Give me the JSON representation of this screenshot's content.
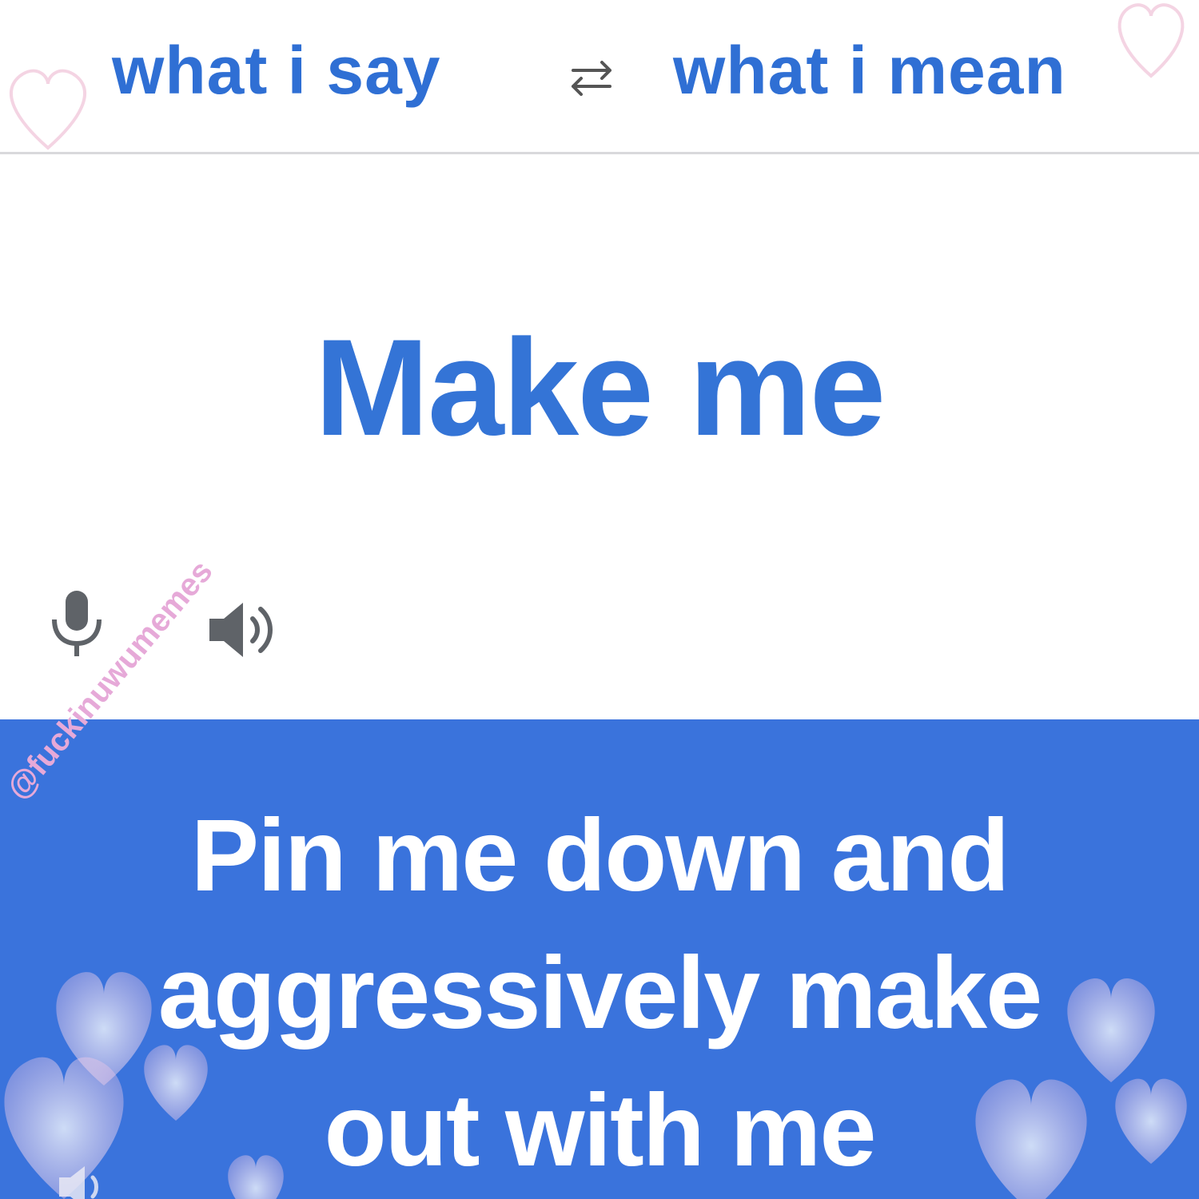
{
  "header": {
    "source_language": "what i say",
    "target_language": "what i mean",
    "swap_icon": "swap-arrows-icon"
  },
  "source": {
    "text": "Make me",
    "mic_icon": "microphone-icon",
    "speaker_icon": "speaker-icon"
  },
  "watermark": {
    "text": "@fuckinuwumemes"
  },
  "result": {
    "text_lines": [
      "Pin me down and",
      "aggressively make",
      "out with me"
    ],
    "speaker_icon": "speaker-icon"
  },
  "colors": {
    "accent": "#2f6fd4",
    "result_background": "#3a73dc",
    "result_text": "#ffffff",
    "watermark": "#e6a9d8",
    "heart": "#f4c6e4"
  }
}
